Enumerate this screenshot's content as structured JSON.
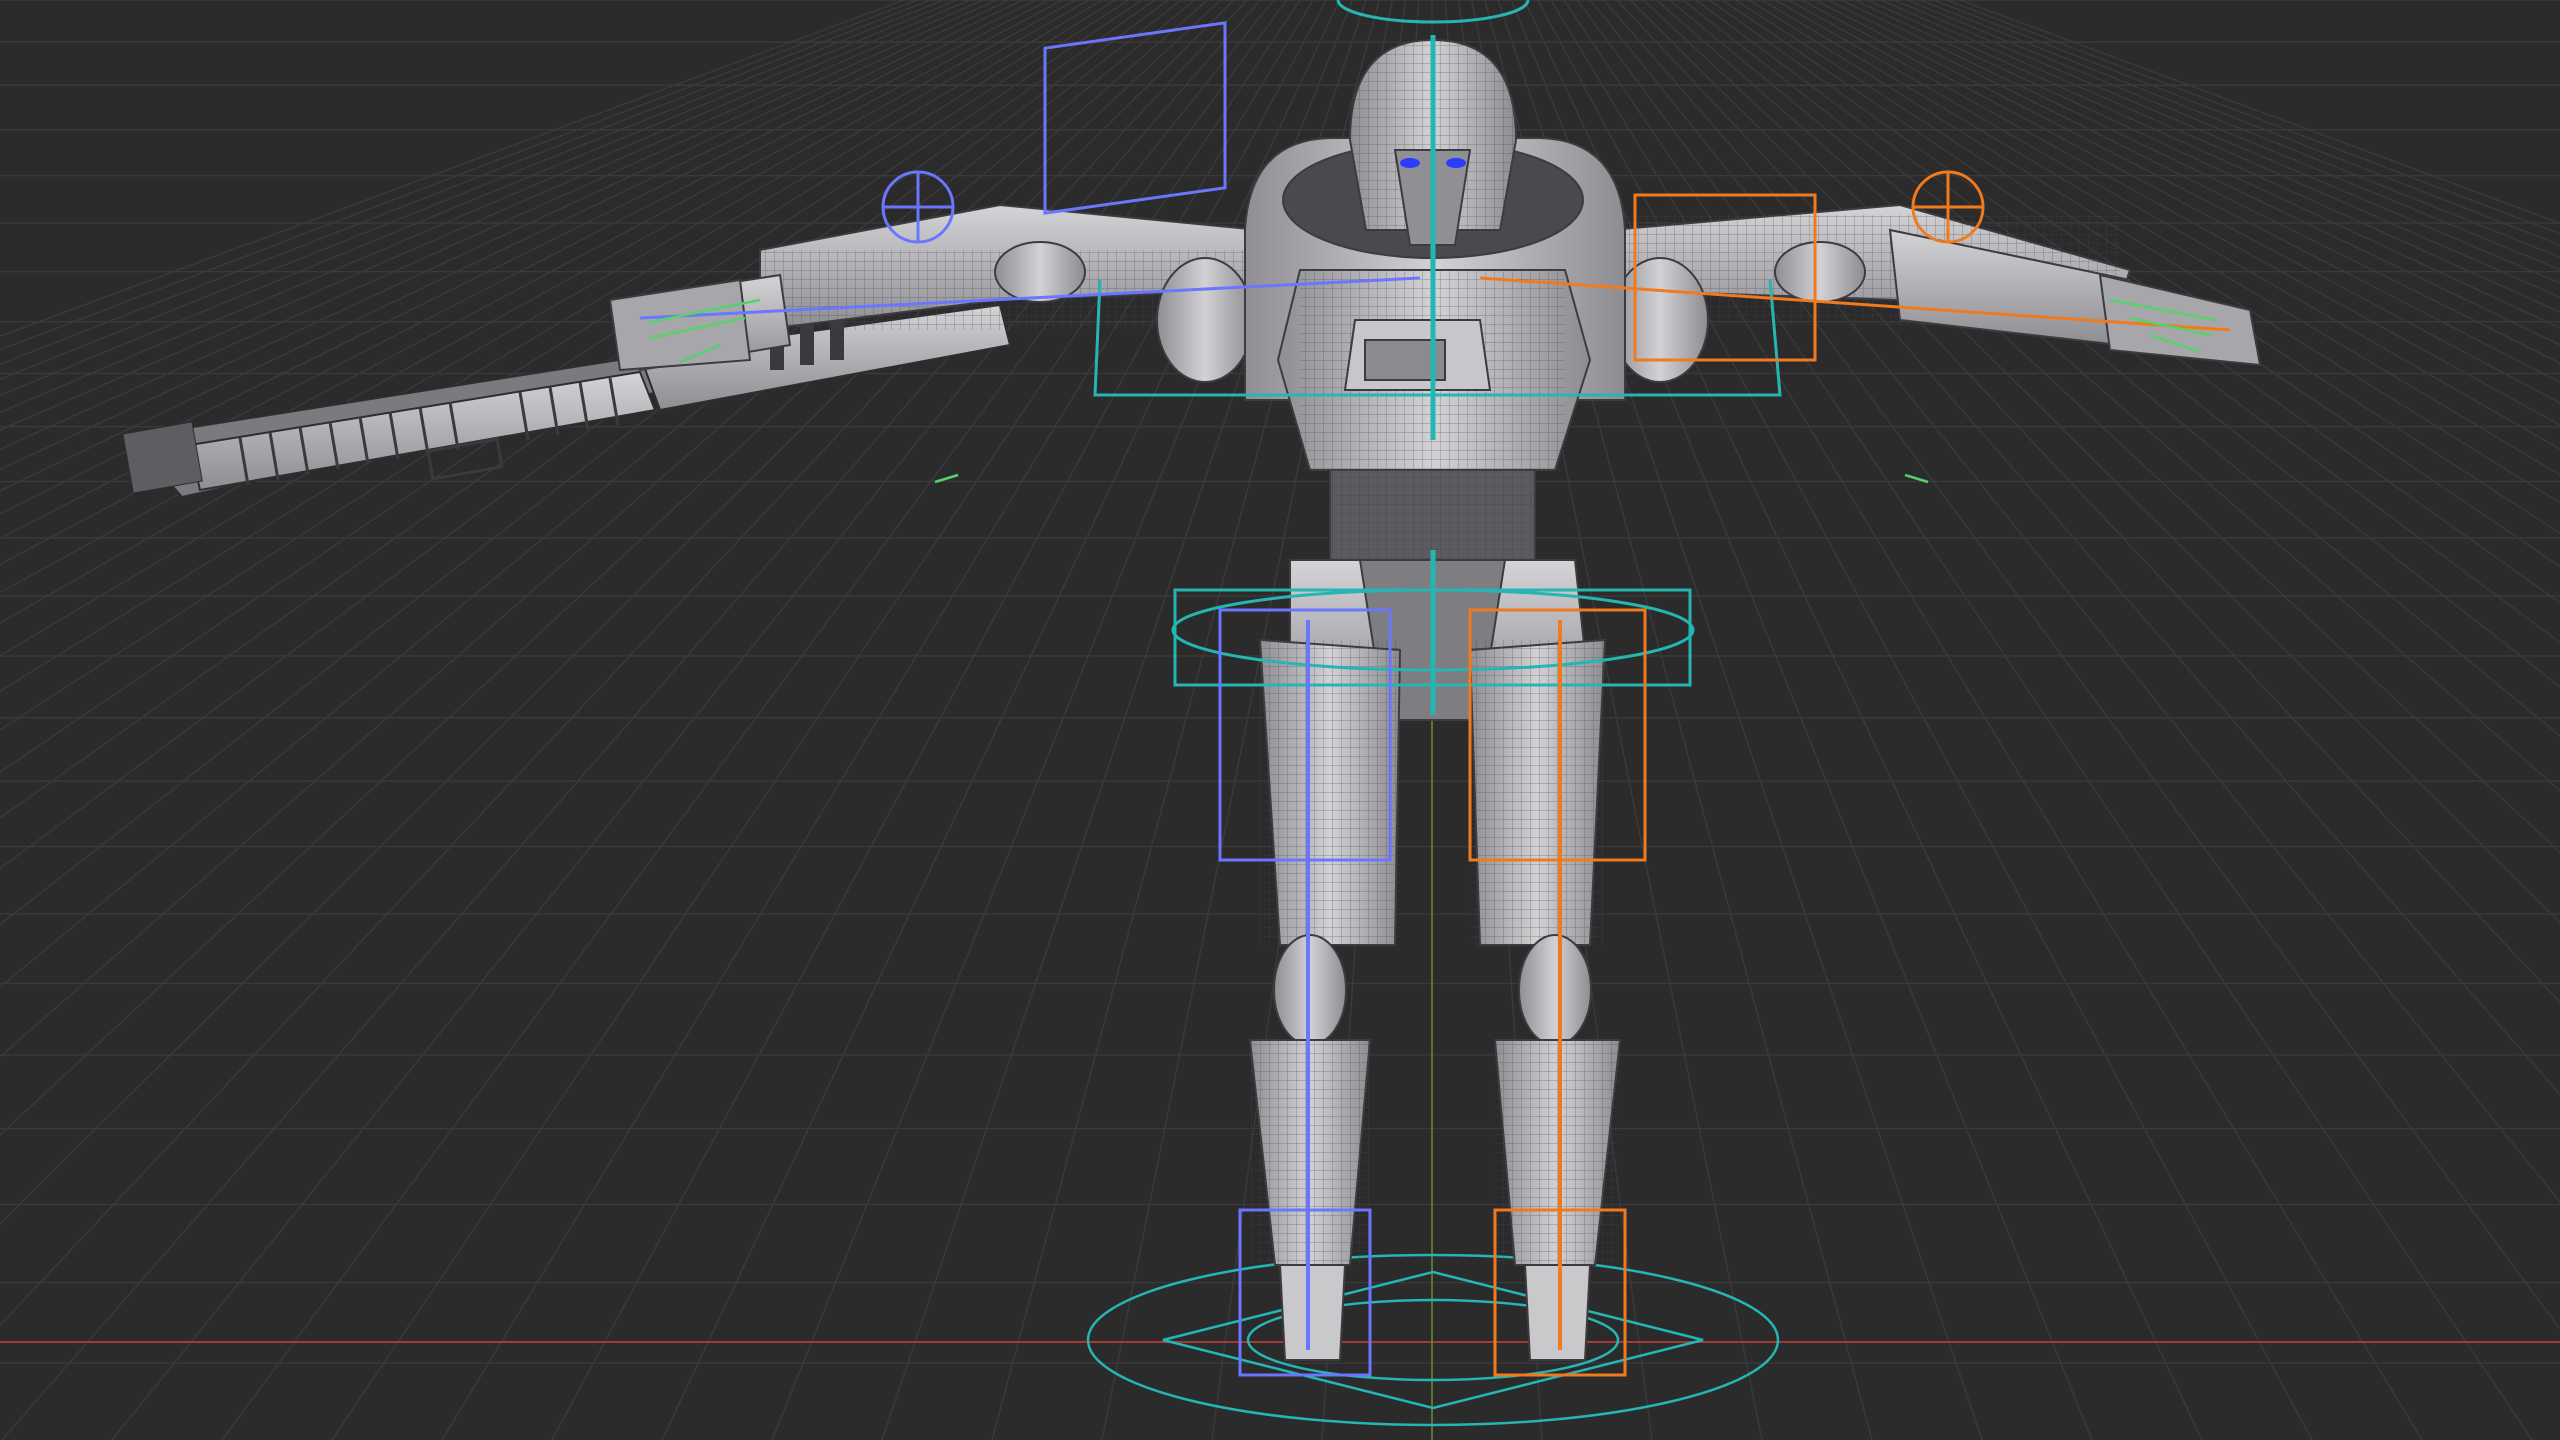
{
  "viewport": {
    "colors": {
      "background": "#2b2b2c",
      "grid_line": "#3a3a3b",
      "axis_x": "#a33a3a",
      "axis_y": "#6f8a2a",
      "mesh_fill": "#b9b9bc",
      "mesh_shadow": "#6e6e72",
      "mesh_wire": "#3c3c40",
      "control_cyan": "#25b6b4",
      "bone_left_blue": "#6b76ff",
      "bone_right_orange": "#f07a1e",
      "bone_finger_green": "#56d16b",
      "eye_blue": "#2a3cff"
    },
    "objects": [
      "grid-floor",
      "robot-mesh",
      "armature",
      "root-control",
      "rifle-mesh"
    ]
  }
}
